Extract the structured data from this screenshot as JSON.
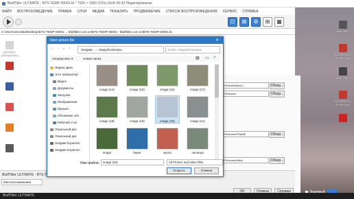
{
  "window": {
    "title": "BluffTitler ULTIMATE - BTS-TEMP-00001.bt  * 7920 × 1080 (51%) (4x4) 00:42 Редактирование",
    "titlebar_app": "BluffTitler ULTIMATE",
    "bottom_title": "BluffTitler ULTIMATE - BTS-TEMP-00001..."
  },
  "menu": [
    "ФАЙЛ",
    "ВОСПРОИЗВЕДЕНИЕ",
    "ПРАВКА",
    "СЛОИ",
    "МЕДИА",
    "ПОКАЗАТЬ",
    "ПРОДВИЖЕНИЕ",
    "СПИСОК ВОСПРОИЗВЕДЕНИЯ",
    "СЕРВИС",
    "СПРАВКА"
  ],
  "pathbar": "C:\\Users\\veronika\\Desktop\\BTS-TEMP-00001 ... Blufftitler.com.vn\\BTS-TEMP-00001 - Blufftitler.com.vn\\BTS-TEMP-00001.bt",
  "right_panel": {
    "fields": [
      ".com.vn\\Textures\\flare1...",
      ".com.vn\\Textures\\",
      ".com.vn\\Textures\\FRAME",
      ".com.vn\\Textures\\effect"
    ],
    "browse_label": "Обзор...",
    "ok_label": "OK",
    "cancel_label": "Отмена",
    "help_label": "Справка",
    "visible_label": "Видимый"
  },
  "dialog": {
    "title": "Open picture file",
    "breadcrumb": [
      "Seagate ...",
      "свадьба валеры"
    ],
    "search_placeholder": "Поиск: свадьба валеры",
    "organize": "Упорядочить ▾",
    "new_folder": "Новая папка",
    "nav_items": [
      {
        "label": "Яндекс.Диск",
        "icon": "cloud-icon",
        "color": "#e8b53d"
      },
      {
        "label": "Этот компьютер",
        "icon": "computer-icon",
        "color": "#4a8bd6"
      },
      {
        "label": "Видео",
        "icon": "video-folder-icon",
        "color": "#6b7fa8"
      },
      {
        "label": "Документы",
        "icon": "documents-folder-icon",
        "color": "#8aa4c8"
      },
      {
        "label": "Загрузки",
        "icon": "downloads-folder-icon",
        "color": "#3c8ad8"
      },
      {
        "label": "Изображения",
        "icon": "pictures-folder-icon",
        "color": "#7ba1c9"
      },
      {
        "label": "Музыка",
        "icon": "music-folder-icon",
        "color": "#5a8cc6"
      },
      {
        "label": "Объемные объ",
        "icon": "3d-objects-icon",
        "color": "#70a7d8"
      },
      {
        "label": "Рабочий стол",
        "icon": "desktop-folder-icon",
        "color": "#3f7fc7"
      },
      {
        "label": "Локальный дис",
        "icon": "drive-icon",
        "color": "#888"
      },
      {
        "label": "Локальный дис",
        "icon": "drive-icon",
        "color": "#888"
      },
      {
        "label": "Seagate Expansio",
        "icon": "drive-icon",
        "color": "#666"
      },
      {
        "label": "Seagate Expansio",
        "icon": "drive-icon",
        "color": "#666"
      }
    ],
    "thumbnails": [
      {
        "label": "image (14)",
        "color": "#9a8f86"
      },
      {
        "label": "image (15)",
        "color": "#6e8a58"
      },
      {
        "label": "image (16)",
        "color": "#7f9a6a"
      },
      {
        "label": "image (17)",
        "color": "#8d8d7a"
      },
      {
        "label": "image (18)",
        "color": "#5c7a4a"
      },
      {
        "label": "image (19)",
        "color": "#a0a6a0"
      },
      {
        "label": "image (20)",
        "color": "#b6c4d4"
      },
      {
        "label": "image (21)",
        "color": "#8a9090"
      },
      {
        "label": "image",
        "color": "#4a6a3a"
      },
      {
        "label": "берег",
        "color": "#2f6ea8"
      },
      {
        "label": "кукла",
        "color": "#c06050"
      },
      {
        "label": "лесница",
        "color": "#7a8a7a"
      }
    ],
    "filename_label": "Имя файла:",
    "filename_value": "image (20)",
    "filetype_value": "All Picture and video files",
    "open_label": "Открыть",
    "cancel_label": "Отмена"
  },
  "desktop": {
    "left_icons": [
      {
        "label": "договор с расторжение...",
        "color": "#d6d6d6"
      },
      {
        "label": "",
        "color": "#c0392b"
      },
      {
        "label": "",
        "color": "#3a5fa0"
      },
      {
        "label": "",
        "color": "#d9534f"
      },
      {
        "label": "",
        "color": "#e67e22"
      },
      {
        "label": "",
        "color": "#5c5c5c"
      }
    ],
    "right_icons": [
      {
        "label": "Alien Skin...",
        "color": "#555"
      },
      {
        "label": "BOOMRANG Smart Pack",
        "color": "#c0392b"
      },
      {
        "label": "Alien Skin...",
        "color": "#444"
      },
      {
        "label": "BOOMRANG Smart Pack",
        "color": "#c0392b"
      },
      {
        "label": "",
        "color": "#cc2222"
      }
    ]
  },
  "bottom": {
    "left_label": "Мои воспоминания"
  },
  "colors": {
    "accent": "#2b78c8",
    "selection": "#cce4f7"
  }
}
